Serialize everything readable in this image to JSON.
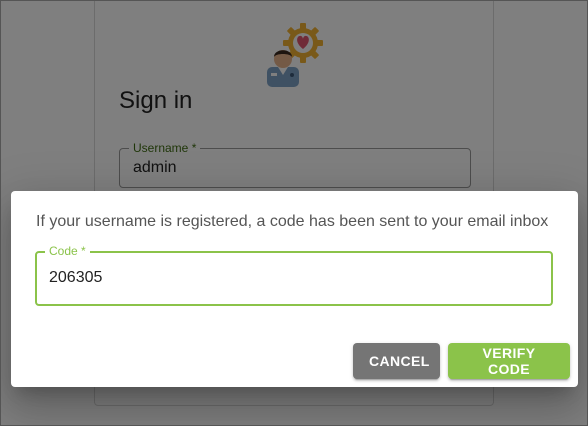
{
  "signin": {
    "title": "Sign in",
    "username_label": "Username *",
    "username_value": "admin",
    "logo_icon": "doctor-gear-heart-icon"
  },
  "dialog": {
    "message": "If your username is registered, a code has been sent to your email inbox",
    "code_label": "Code *",
    "code_value": "206305",
    "cancel_label": "CANCEL",
    "verify_label": "VERIFY CODE"
  },
  "colors": {
    "accent": "#8bc34a",
    "cancel": "#757575",
    "label_dark_green": "#3f6d12"
  }
}
